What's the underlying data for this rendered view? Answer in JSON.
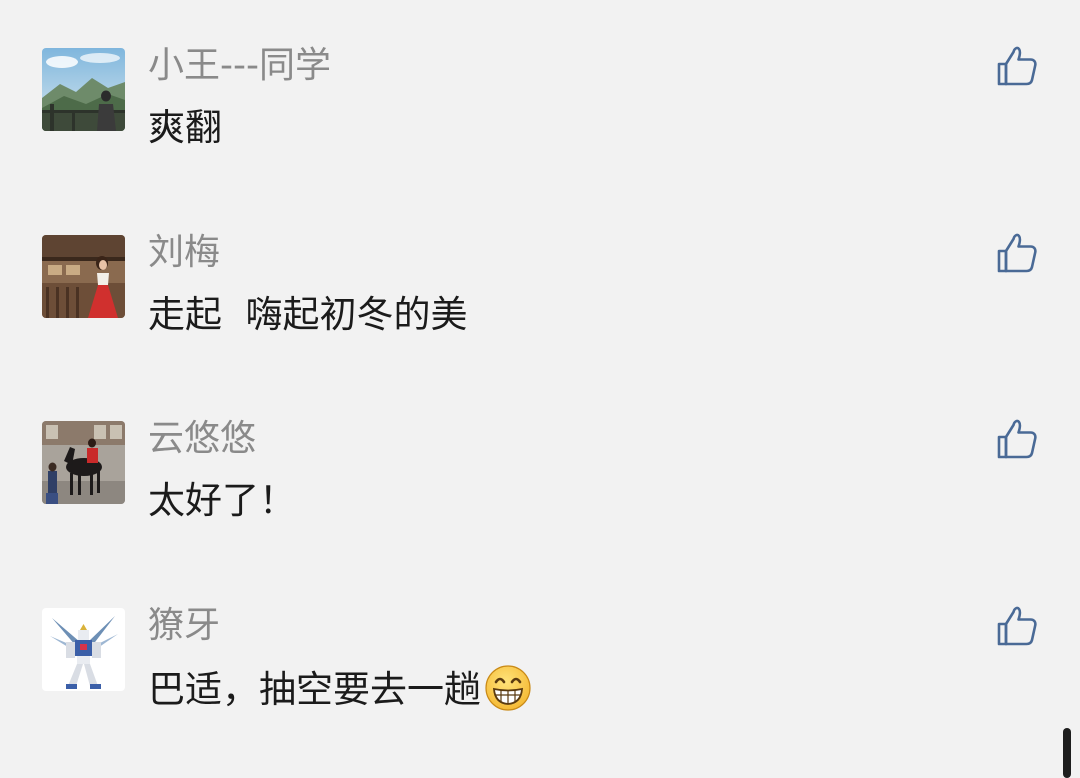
{
  "comments": [
    {
      "username": "小王---同学",
      "message": "爽翻",
      "avatar": "mountain-view-photo",
      "like_icon": "thumbs-up-icon"
    },
    {
      "username": "刘梅",
      "message": "走起  嗨起初冬的美",
      "avatar": "woman-red-dress-photo",
      "like_icon": "thumbs-up-icon"
    },
    {
      "username": "云悠悠",
      "message": "太好了！",
      "avatar": "horse-rider-photo",
      "like_icon": "thumbs-up-icon"
    },
    {
      "username": "獠牙",
      "message": "巴适，抽空要去一趟",
      "avatar": "gundam-robot-photo",
      "emoji": "grinning-face-emoji",
      "like_icon": "thumbs-up-icon"
    }
  ],
  "colors": {
    "background": "#f2f2f2",
    "username": "#8a8a8a",
    "message": "#1b1b1b",
    "like_icon": "#4a6a96"
  }
}
